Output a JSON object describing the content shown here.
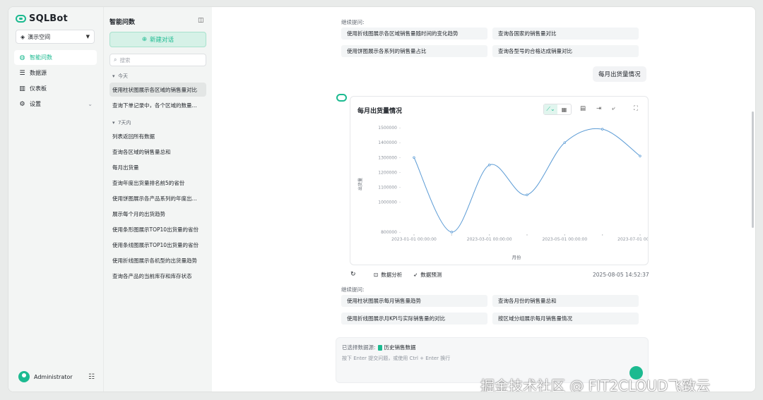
{
  "brand": {
    "name": "SQLBot"
  },
  "workspace": {
    "label": "演示空间"
  },
  "nav": {
    "items": [
      {
        "label": "智能问数",
        "icon": "chat-icon",
        "active": true
      },
      {
        "label": "数据源",
        "icon": "database-icon"
      },
      {
        "label": "仪表板",
        "icon": "dashboard-icon"
      },
      {
        "label": "设置",
        "icon": "gear-icon"
      }
    ]
  },
  "user": {
    "name": "Administrator"
  },
  "chatlist": {
    "title": "智能问数",
    "new_chat": "新建对话",
    "search_placeholder": "搜索",
    "today_label": "今天",
    "today": [
      "使用柱状图展示各区域的销售量对比",
      "查询下单记录中，各个区域的数量..."
    ],
    "week_label": "7天内",
    "week": [
      "列表返回所有数据",
      "查询各区域的销售量总和",
      "每月出货量",
      "查询年度出货量排名前5的省份",
      "使用饼图展示各产品系列的年度出...",
      "展示每个月的出货趋势",
      "使用条形图展示TOP10出货量的省份",
      "使用条线图展示TOP10出货量的省份",
      "使用折线图展示各机型的出货量趋势",
      "查询各产品的当前库存和库存状态"
    ]
  },
  "conversation": {
    "followup_label": "继续提问:",
    "suggestions_top": [
      "使用折线图展示各区域销售量随时间的变化趋势",
      "查询各国家的销售量对比",
      "使用饼图展示各系列的销售量占比",
      "查询各型号的合格达成销量对比"
    ],
    "user_message": "每月出货量情况",
    "chart_title": "每月出货量情况",
    "actions": {
      "analysis": "数据分析",
      "predict": "数据预测"
    },
    "timestamp": "2025-08-05 14:52:37",
    "suggestions_bottom": [
      "使用柱状图展示每月销售量趋势",
      "查询各月份的销售量总和",
      "使用折线图展示月KPI与实际销售量的对比",
      "按区域分组展示每月销售量情况"
    ]
  },
  "input": {
    "datasource_label": "已选择数据源:",
    "datasource_name": "历史销售数据",
    "placeholder": "按下 Enter 提交问题，或使用 Ctrl + Enter 换行"
  },
  "watermark": "掘金技术社区 @ FIT2CLOUD飞致云",
  "colors": {
    "accent": "#1cba90",
    "series": "#5b9bd5"
  },
  "chart_data": {
    "type": "line",
    "title": "每月出货量情况",
    "xlabel": "月份",
    "ylabel": "出货量",
    "x": [
      "2023-01-01 00:00:00",
      "2023-02-01 00:00:00",
      "2023-03-01 00:00:00",
      "2023-04-01 00:00:00",
      "2023-05-01 00:00:00",
      "2023-06-01 00:00:00",
      "2023-07-01 00:00:00"
    ],
    "x_tick_labels": [
      "2023-01-01 00:00:00",
      "2023-03-01 00:00:00",
      "2023-05-01 00:00:00",
      "2023-07-01 00:00:00"
    ],
    "values": [
      1300000,
      800000,
      1250000,
      1050000,
      1400000,
      1490000,
      1310000
    ],
    "y_ticks": [
      800000,
      1000000,
      1100000,
      1200000,
      1300000,
      1400000,
      1500000
    ],
    "y_tick_labels": [
      "800000",
      "1000000",
      "1100000",
      "1200000",
      "1300000",
      "1400000",
      "1500000"
    ],
    "y_axis_points": [
      800000,
      900000,
      1000000,
      1100000,
      1200000,
      1300000,
      1400000,
      1500000
    ],
    "ylim": [
      800000,
      1500000
    ],
    "grid": false,
    "smooth": true
  }
}
